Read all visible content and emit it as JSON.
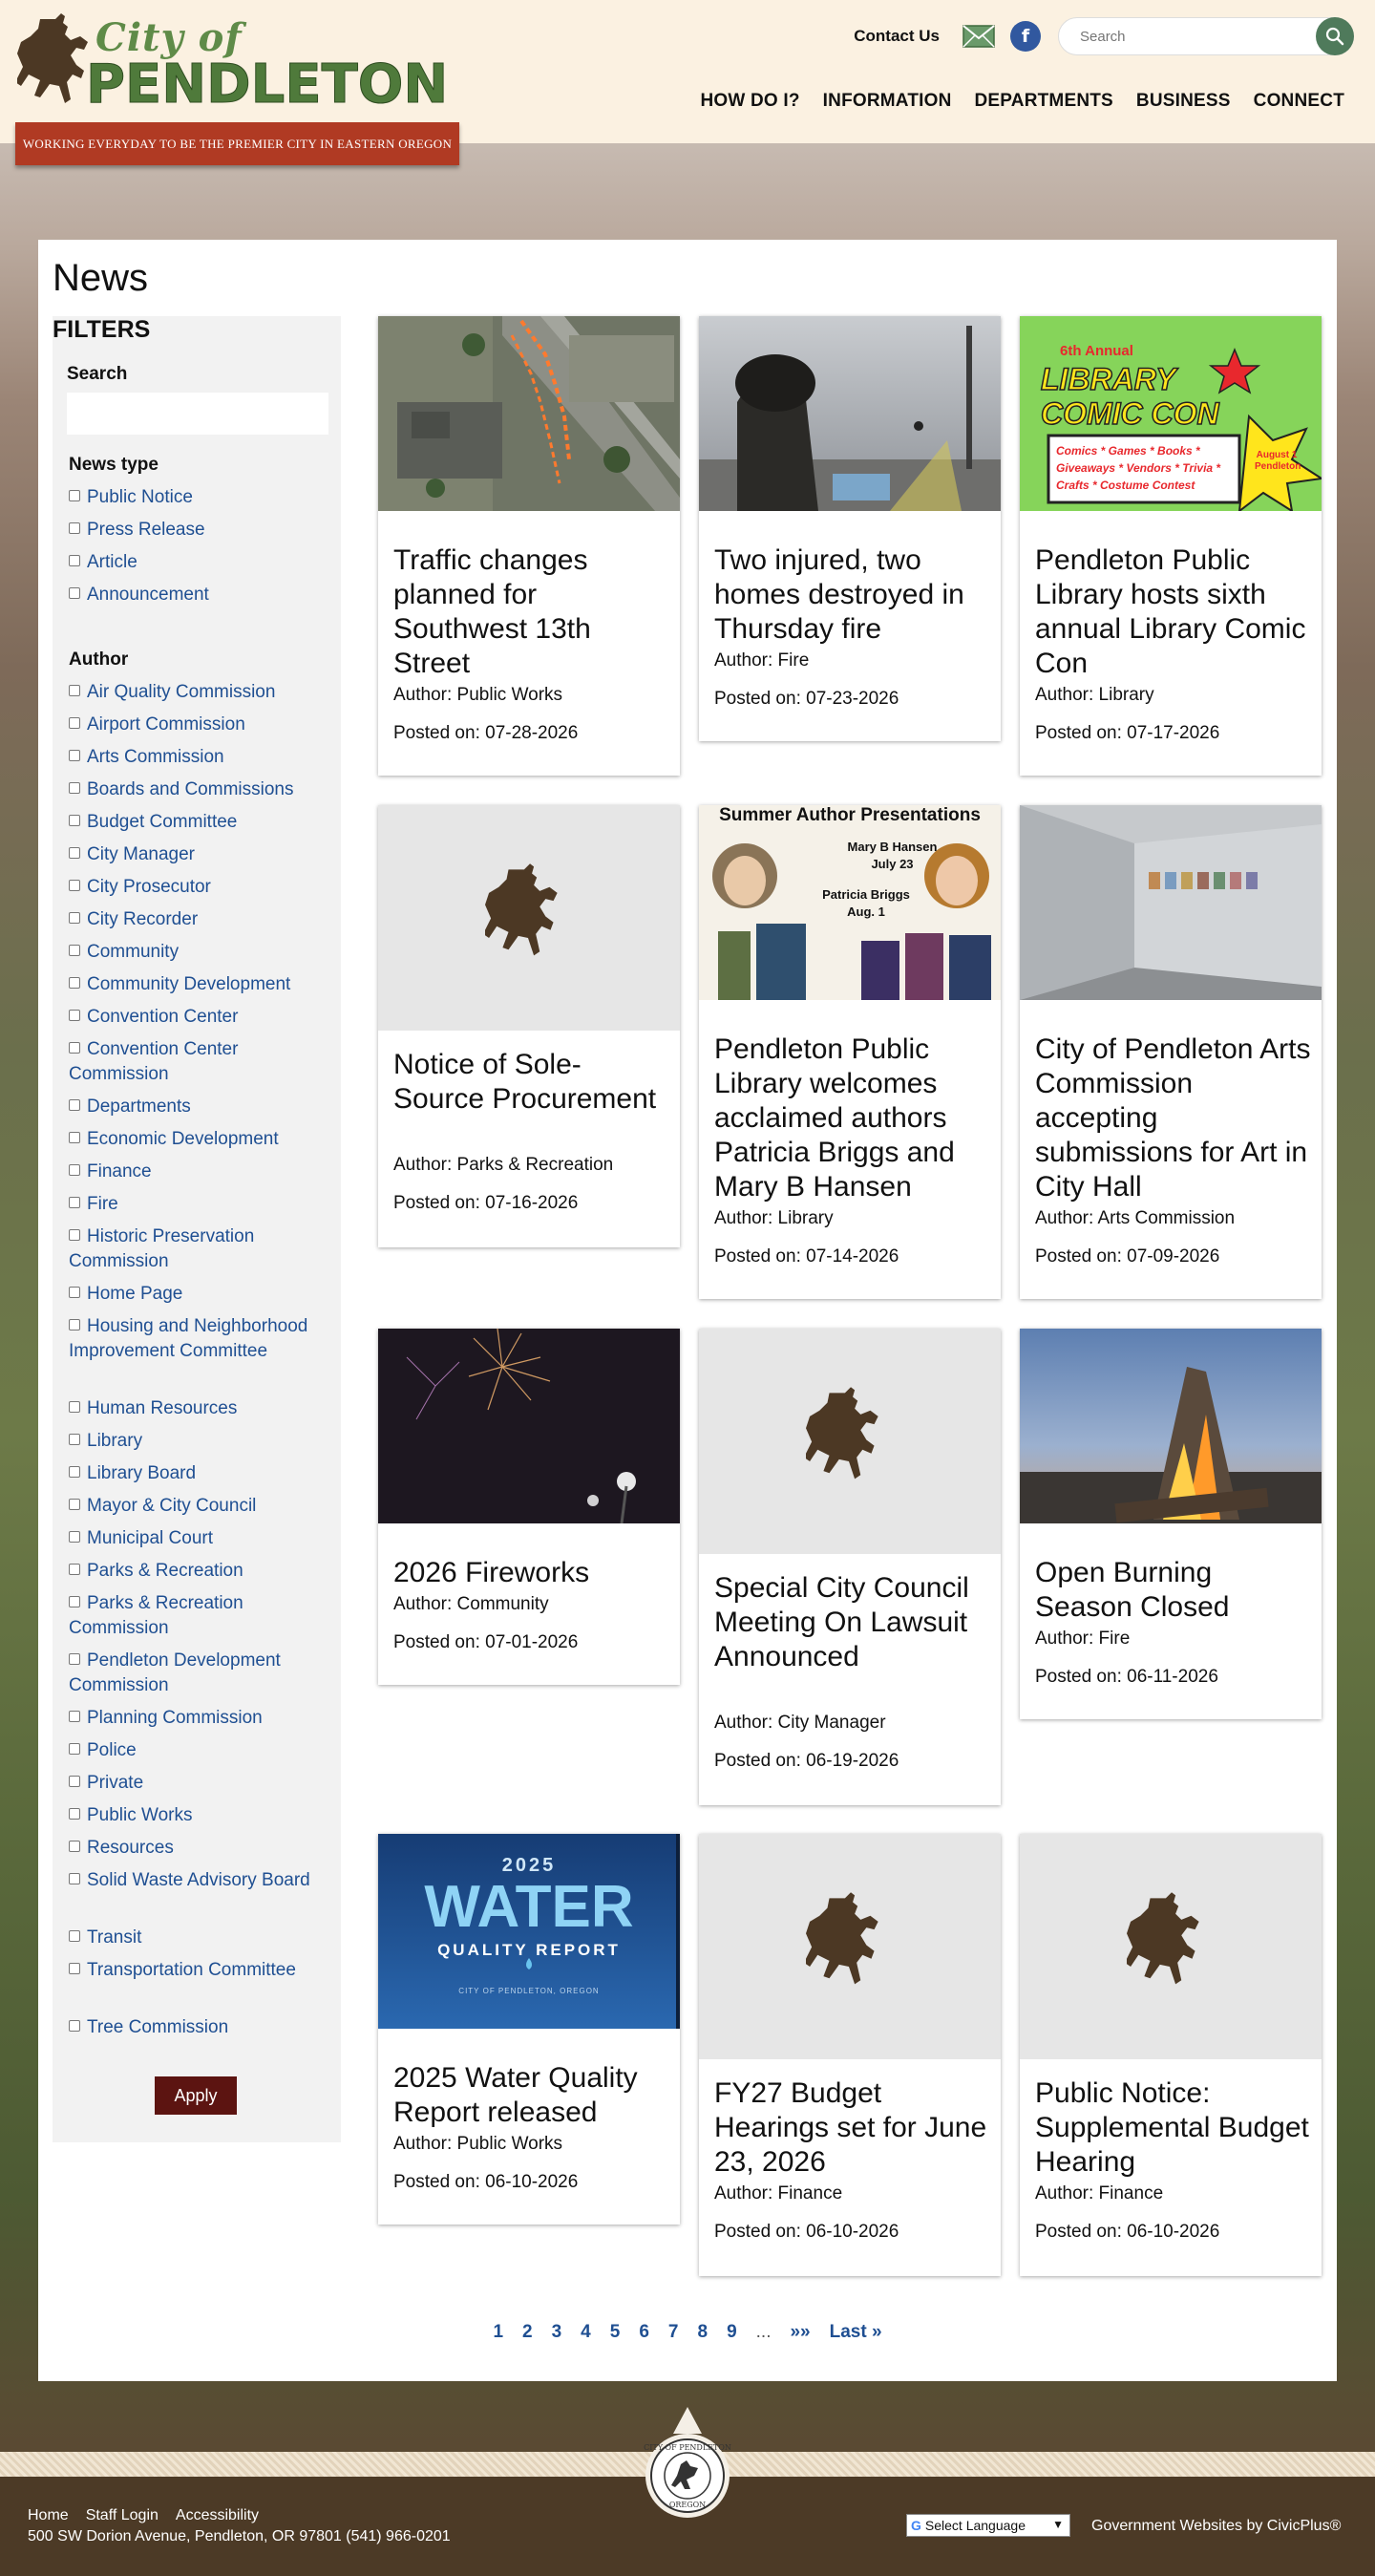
{
  "header": {
    "logo": {
      "city_of": "City of",
      "name": "PENDLETON"
    },
    "tagline": "WORKING EVERYDAY TO BE THE PREMIER CITY IN EASTERN OREGON",
    "contact_label": "Contact Us",
    "search_placeholder": "Search",
    "nav": [
      "HOW DO I?",
      "INFORMATION",
      "DEPARTMENTS",
      "BUSINESS",
      "CONNECT"
    ]
  },
  "page": {
    "title": "News"
  },
  "filters": {
    "title": "FILTERS",
    "search_label": "Search",
    "news_type_title": "News type",
    "news_types": [
      "Public Notice",
      "Press Release",
      "Article",
      "Announcement"
    ],
    "author_title": "Author",
    "authors": [
      "Air Quality Commission",
      "Airport Commission",
      "Arts Commission",
      "Boards and Commissions",
      "Budget Committee",
      "City Manager",
      "City Prosecutor",
      "City Recorder",
      "Community",
      "Community Development",
      "Convention Center",
      "Convention Center Commission",
      "Departments",
      "Economic Development",
      "Finance",
      "Fire",
      "Historic Preservation Commission",
      "Home Page",
      "Housing and Neighborhood Improvement Committee",
      "Human Resources",
      "Library",
      "Library Board",
      "Mayor & City Council",
      "Municipal Court",
      "Parks & Recreation",
      "Parks & Recreation Commission",
      "Pendleton Development Commission",
      "Planning Commission",
      "Police",
      "Private",
      "Public Works",
      "Resources",
      "Solid Waste Advisory Board",
      "Transit",
      "Transportation Committee",
      "Tree Commission"
    ],
    "apply_label": "Apply"
  },
  "cards": [
    {
      "title": "Traffic changes planned for Southwest 13th Street",
      "author": "Author: Public Works",
      "posted": "Posted on: 07-28-2026",
      "image": "aerial-map-image"
    },
    {
      "title": "Two injured, two homes destroyed in Thursday fire",
      "author": "Author: Fire",
      "posted": "Posted on: 07-23-2026",
      "image": "firefighter-image"
    },
    {
      "title": "Pendleton Public Library hosts sixth annual Library Comic Con",
      "author": "Author: Library",
      "posted": "Posted on: 07-17-2026",
      "image": "comic-con-image",
      "image_text": {
        "edition": "6th Annual",
        "headline": "LIBRARY COMIC CON",
        "items": "Comics * Games * Books * Giveaways * Vendors * Trivia * Crafts * Costume Contest",
        "date": "August 1 Pendleton"
      }
    },
    {
      "title": "Notice of Sole-Source Procurement",
      "author": "Author: Parks & Recreation",
      "posted": "Posted on: 07-16-2026",
      "image": "placeholder"
    },
    {
      "title": "Pendleton Public Library welcomes acclaimed authors Patricia Briggs and Mary B Hansen",
      "author": "Author: Library",
      "posted": "Posted on: 07-14-2026",
      "image": "authors-image",
      "image_text": {
        "headline": "Summer Author Presentations",
        "author1": "Mary B Hansen",
        "date1": "July 23",
        "author2": "Patricia Briggs",
        "date2": "Aug. 1"
      }
    },
    {
      "title": "City of Pendleton Arts Commission accepting submissions for Art in City Hall",
      "author": "Author: Arts Commission",
      "posted": "Posted on: 07-09-2026",
      "image": "hallway-image"
    },
    {
      "title": "2026 Fireworks",
      "author": "Author: Community",
      "posted": "Posted on: 07-01-2026",
      "image": "fireworks-image"
    },
    {
      "title": "Special City Council Meeting On Lawsuit Announced",
      "author": "Author: City Manager",
      "posted": "Posted on: 06-19-2026",
      "image": "placeholder"
    },
    {
      "title": "Open Burning Season Closed",
      "author": "Author: Fire",
      "posted": "Posted on: 06-11-2026",
      "image": "campfire-image"
    },
    {
      "title": "2025 Water Quality Report released",
      "author": "Author: Public Works",
      "posted": "Posted on: 06-10-2026",
      "image": "water-report-image",
      "image_text": {
        "year": "2025",
        "headline": "WATER",
        "sub": "QUALITY REPORT",
        "footer": "CITY OF PENDLETON, OREGON"
      }
    },
    {
      "title": "FY27 Budget Hearings set for June 23, 2026",
      "author": "Author: Finance",
      "posted": "Posted on: 06-10-2026",
      "image": "placeholder"
    },
    {
      "title": "Public Notice: Supplemental Budget Hearing",
      "author": "Author: Finance",
      "posted": "Posted on: 06-10-2026",
      "image": "placeholder"
    }
  ],
  "pagination": {
    "pages": [
      "1",
      "2",
      "3",
      "4",
      "5",
      "6",
      "7",
      "8",
      "9"
    ],
    "ellipsis": "...",
    "next": "»»",
    "last": "Last »"
  },
  "footer": {
    "links": [
      "Home",
      "Staff Login",
      "Accessibility"
    ],
    "address": "500 SW Dorion Avenue, Pendleton, OR 97801 (541) 966-0201",
    "language_label": "Select Language",
    "credit": "Government Websites by CivicPlus®",
    "seal_text": {
      "top": "CITY OF PENDLETON",
      "bottom": "OREGON"
    }
  },
  "colors": {
    "link": "#1f4f92",
    "tagline": "#b03a23",
    "apply": "#5c1411",
    "footer": "#4c3a26",
    "logo_green": "#4f7a3b"
  }
}
